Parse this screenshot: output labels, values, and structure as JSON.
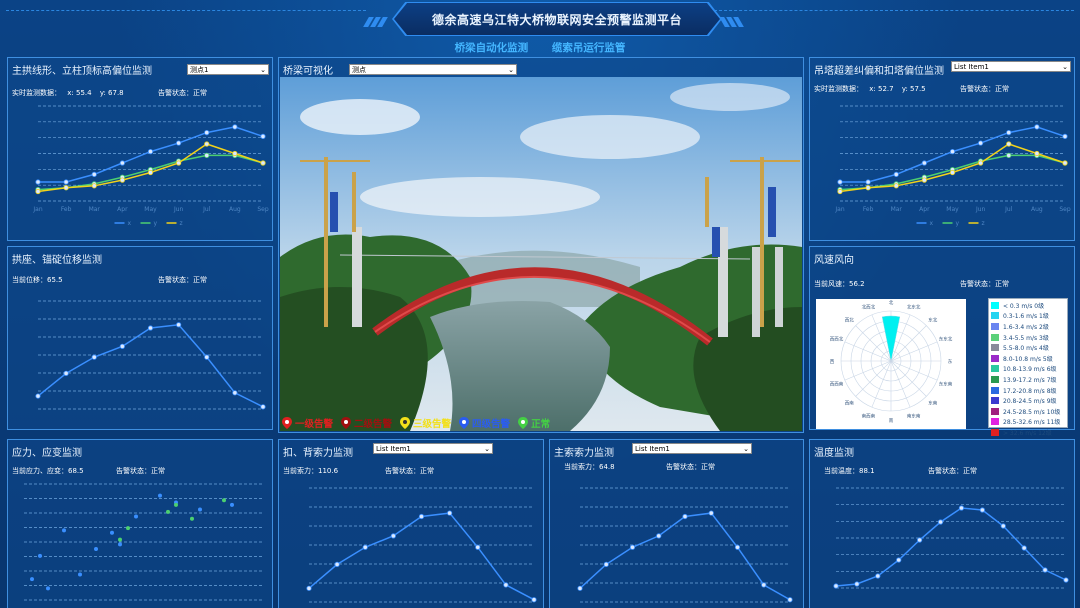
{
  "app": {
    "title": "德余高速乌江特大桥物联网安全预警监测平台",
    "nav": [
      "桥梁自动化监测",
      "缆索吊运行监管"
    ]
  },
  "colors": {
    "accent": "#44b6ff",
    "line_blue": "#3a8fff",
    "line_green": "#4ccf70",
    "line_yellow": "#f2d21a"
  },
  "panels": {
    "arch": {
      "title": "主拱线形、立柱顶标高偏位监测",
      "select": "测点1",
      "realtime_label": "实时监测数据：",
      "x_label": "x:",
      "x_value": "55.4",
      "y_label": "y:",
      "y_value": "67.8",
      "alarm_label": "告警状态：",
      "alarm_value": "正常",
      "legend": [
        "x",
        "y",
        "z"
      ],
      "xticks": [
        "Jan",
        "Feb",
        "Mar",
        "Apr",
        "May",
        "Jun",
        "Jul",
        "Aug",
        "Sep"
      ]
    },
    "visual": {
      "title": "桥梁可视化",
      "select": "测点",
      "alarms": [
        {
          "label": "一级告警",
          "color": "#e02020"
        },
        {
          "label": "二级告警",
          "color": "#a01010"
        },
        {
          "label": "三级告警",
          "color": "#f2e01a"
        },
        {
          "label": "四级告警",
          "color": "#2a5cf0"
        },
        {
          "label": "正常",
          "color": "#44d044"
        }
      ]
    },
    "tower": {
      "title": "吊塔超差纠偏和扣塔偏位监测",
      "select": "List Item1",
      "realtime_label": "实时监测数据：",
      "x_label": "x:",
      "x_value": "52.7",
      "y_label": "y:",
      "y_value": "57.5",
      "alarm_label": "告警状态：",
      "alarm_value": "正常",
      "legend": [
        "x",
        "y",
        "z"
      ],
      "xticks": [
        "Jan",
        "Feb",
        "Mar",
        "Apr",
        "May",
        "Jun",
        "Jul",
        "Aug",
        "Sep"
      ]
    },
    "anchor": {
      "title": "拱座、锚碇位移监测",
      "current_label": "当前位移：",
      "current_value": "65.5",
      "alarm_label": "告警状态：",
      "alarm_value": "正常"
    },
    "wind": {
      "title": "风速风向",
      "current_label": "当前风速：",
      "current_value": "56.2",
      "alarm_label": "告警状态：",
      "alarm_value": "正常",
      "directions": [
        "北",
        "北东北",
        "东北",
        "东东北",
        "东",
        "东东南",
        "东南",
        "南东南",
        "南",
        "南西南",
        "西南",
        "西西南",
        "西",
        "西西北",
        "西北",
        "北西北"
      ],
      "legend": [
        {
          "label": "< 0.3 m/s 0级",
          "color": "#00ffff"
        },
        {
          "label": "0.3-1.6 m/s 1级",
          "color": "#25d4f0"
        },
        {
          "label": "1.6-3.4 m/s 2级",
          "color": "#6a85f0"
        },
        {
          "label": "3.4-5.5 m/s 3级",
          "color": "#5bd17a"
        },
        {
          "label": "5.5-8.0 m/s 4级",
          "color": "#8a8a9a"
        },
        {
          "label": "8.0-10.8 m/s 5级",
          "color": "#9a2ac8"
        },
        {
          "label": "10.8-13.9 m/s 6级",
          "color": "#2ac8a0"
        },
        {
          "label": "13.9-17.2 m/s 7级",
          "color": "#2a9a50"
        },
        {
          "label": "17.2-20.8 m/s 8级",
          "color": "#2a6ae0"
        },
        {
          "label": "20.8-24.5 m/s 9级",
          "color": "#3a3ad0"
        },
        {
          "label": "24.5-28.5 m/s 10级",
          "color": "#a02080"
        },
        {
          "label": "28.5-32.6 m/s 11级",
          "color": "#e020e0"
        },
        {
          "label": "> 32.6 m/s 12级",
          "color": "#e02020"
        }
      ]
    },
    "stress": {
      "title": "应力、应变监测",
      "current_label": "当前应力、应变：",
      "current_value": "68.5",
      "alarm_label": "告警状态：",
      "alarm_value": "正常"
    },
    "backcable": {
      "title": "扣、背索力监测",
      "select": "List Item1",
      "current_label": "当前索力：",
      "current_value": "110.6",
      "alarm_label": "告警状态：",
      "alarm_value": "正常"
    },
    "maincable": {
      "title": "主索索力监测",
      "select": "List Item1",
      "current_label": "当前索力：",
      "current_value": "64.8",
      "alarm_label": "告警状态：",
      "alarm_value": "正常"
    },
    "temp": {
      "title": "温度监测",
      "current_label": "当前温度：",
      "current_value": "88.1",
      "alarm_label": "告警状态：",
      "alarm_value": "正常"
    }
  },
  "chart_data": [
    {
      "type": "line",
      "panel": "arch",
      "categories": [
        "Jan",
        "Feb",
        "Mar",
        "Apr",
        "May",
        "Jun",
        "Jul",
        "Aug",
        "Sep"
      ],
      "series": [
        {
          "name": "x",
          "values": [
            20,
            20,
            28,
            40,
            52,
            61,
            72,
            78,
            68
          ]
        },
        {
          "name": "y",
          "values": [
            12,
            14,
            18,
            25,
            33,
            42,
            48,
            48,
            40
          ]
        },
        {
          "name": "z",
          "values": [
            10,
            14,
            16,
            22,
            30,
            40,
            60,
            50,
            40
          ]
        }
      ],
      "ylim": [
        0,
        100
      ]
    },
    {
      "type": "line",
      "panel": "tower",
      "categories": [
        "Jan",
        "Feb",
        "Mar",
        "Apr",
        "May",
        "Jun",
        "Jul",
        "Aug",
        "Sep"
      ],
      "series": [
        {
          "name": "x",
          "values": [
            20,
            20,
            28,
            40,
            52,
            61,
            72,
            78,
            68
          ]
        },
        {
          "name": "y",
          "values": [
            12,
            14,
            18,
            25,
            33,
            42,
            48,
            48,
            40
          ]
        },
        {
          "name": "z",
          "values": [
            10,
            14,
            16,
            22,
            30,
            40,
            60,
            50,
            40
          ]
        }
      ],
      "ylim": [
        0,
        100
      ]
    },
    {
      "type": "line",
      "panel": "anchor",
      "series": [
        {
          "values": [
            12,
            33,
            48,
            58,
            75,
            78,
            48,
            15,
            2
          ]
        }
      ],
      "ylim": [
        0,
        100
      ]
    },
    {
      "type": "line",
      "panel": "backcable",
      "series": [
        {
          "values": [
            12,
            33,
            48,
            58,
            75,
            78,
            48,
            15,
            2
          ]
        }
      ],
      "ylim": [
        0,
        100
      ]
    },
    {
      "type": "line",
      "panel": "maincable",
      "series": [
        {
          "values": [
            12,
            33,
            48,
            58,
            75,
            78,
            48,
            15,
            2
          ]
        }
      ],
      "ylim": [
        0,
        100
      ]
    },
    {
      "type": "line",
      "panel": "temp",
      "series": [
        {
          "values": [
            2,
            4,
            12,
            28,
            48,
            66,
            80,
            78,
            62,
            40,
            18,
            8
          ]
        }
      ],
      "ylim": [
        0,
        100
      ]
    },
    {
      "type": "scatter",
      "panel": "stress",
      "series": [
        {
          "name": "a",
          "values": [
            [
              1,
              18
            ],
            [
              2,
              38
            ],
            [
              3,
              10
            ],
            [
              5,
              60
            ],
            [
              7,
              22
            ],
            [
              9,
              44
            ],
            [
              11,
              58
            ],
            [
              12,
              48
            ],
            [
              14,
              72
            ],
            [
              17,
              90
            ],
            [
              19,
              84
            ],
            [
              22,
              78
            ],
            [
              26,
              82
            ]
          ]
        },
        {
          "name": "b",
          "values": [
            [
              12,
              52
            ],
            [
              13,
              62
            ],
            [
              18,
              76
            ],
            [
              19,
              82
            ],
            [
              21,
              70
            ],
            [
              25,
              86
            ]
          ]
        }
      ],
      "xlim": [
        0,
        30
      ],
      "ylim": [
        0,
        100
      ]
    },
    {
      "type": "polar",
      "panel": "wind",
      "directions": [
        "北",
        "北东北",
        "东北",
        "东东北",
        "东",
        "东东南",
        "东南",
        "南东南",
        "南",
        "南西南",
        "西南",
        "西西南",
        "西",
        "西西北",
        "西北",
        "北西北"
      ],
      "values": [
        9,
        0,
        0,
        0,
        0,
        0,
        0,
        0,
        0,
        0,
        0,
        0,
        0,
        0,
        0,
        0
      ],
      "rlim": [
        0,
        10
      ]
    }
  ]
}
